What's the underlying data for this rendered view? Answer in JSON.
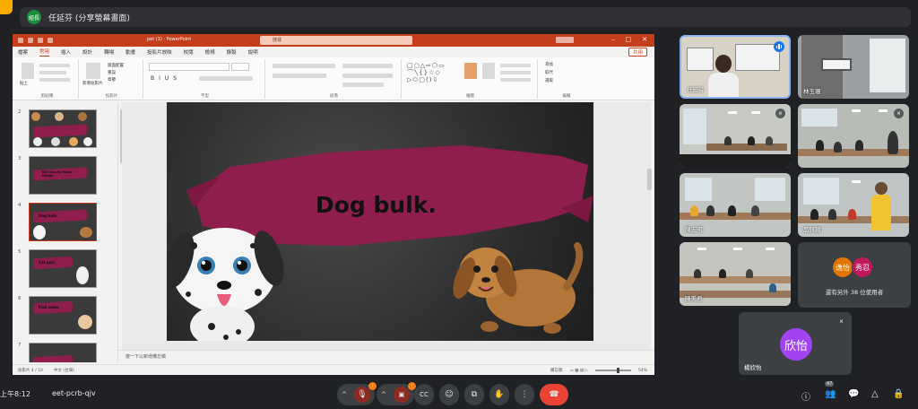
{
  "meet": {
    "presenter_avatar": "組長",
    "presenter_title": "任延芬 (分享螢幕畫面)",
    "clock": "上午8:12",
    "meeting_code": "eet-pcrb-qjv",
    "participants_count": "47"
  },
  "powerpoint": {
    "doc_title": "pet (1) · PowerPoint",
    "search_placeholder": "搜尋",
    "menu": [
      "檔案",
      "常用",
      "插入",
      "設計",
      "轉場",
      "動畫",
      "投影片放映",
      "校閱",
      "檢視",
      "錄製",
      "說明"
    ],
    "active_menu": "常用",
    "share_label": "共用",
    "ribbon_groups": [
      "剪貼簿",
      "投影片",
      "字型",
      "段落",
      "繪圖",
      "編輯"
    ],
    "ribbon_labels": {
      "paste": "貼上",
      "new_slide": "新增投影片",
      "layout": "版面配置",
      "reset": "重設",
      "section": "章節",
      "find": "尋找",
      "replace": "取代",
      "select": "選取"
    },
    "thumbnails": [
      {
        "num": "2",
        "text": ""
      },
      {
        "num": "3",
        "text": "Did you do many things"
      },
      {
        "num": "4",
        "text": "Dog bulk."
      },
      {
        "num": "5",
        "text": "Cat purr."
      },
      {
        "num": "6",
        "text": "Fish swim."
      },
      {
        "num": "7",
        "text": ""
      }
    ],
    "slide_title": "Dog bulk.",
    "notes_placeholder": "按一下以新增備忘稿",
    "status_slide": "投影片 4 / 10",
    "status_lang": "中文 (台灣)",
    "status_notes": "備忘稿",
    "status_zoom": "54%"
  },
  "tiles": [
    {
      "name": "任延芬",
      "speaking": true
    },
    {
      "name": "林玉珊",
      "speaking": false
    },
    {
      "name": "",
      "speaking": false
    },
    {
      "name": "",
      "speaking": false
    },
    {
      "name": "陳志明",
      "speaking": false
    },
    {
      "name": "吳佩穎",
      "speaking": false
    },
    {
      "name": "陳美君",
      "speaking": false
    }
  ],
  "others": {
    "avatar1": "逸怡",
    "avatar2": "秀忍",
    "text": "還有另外 38 位使用者"
  },
  "solo": {
    "avatar": "欣怡",
    "name": "楊欣怡"
  },
  "colors": {
    "ppt_accent": "#c43e1c",
    "brush": "#8f1d4d",
    "end_call": "#ea4335",
    "speaking": "#1a73e8"
  }
}
